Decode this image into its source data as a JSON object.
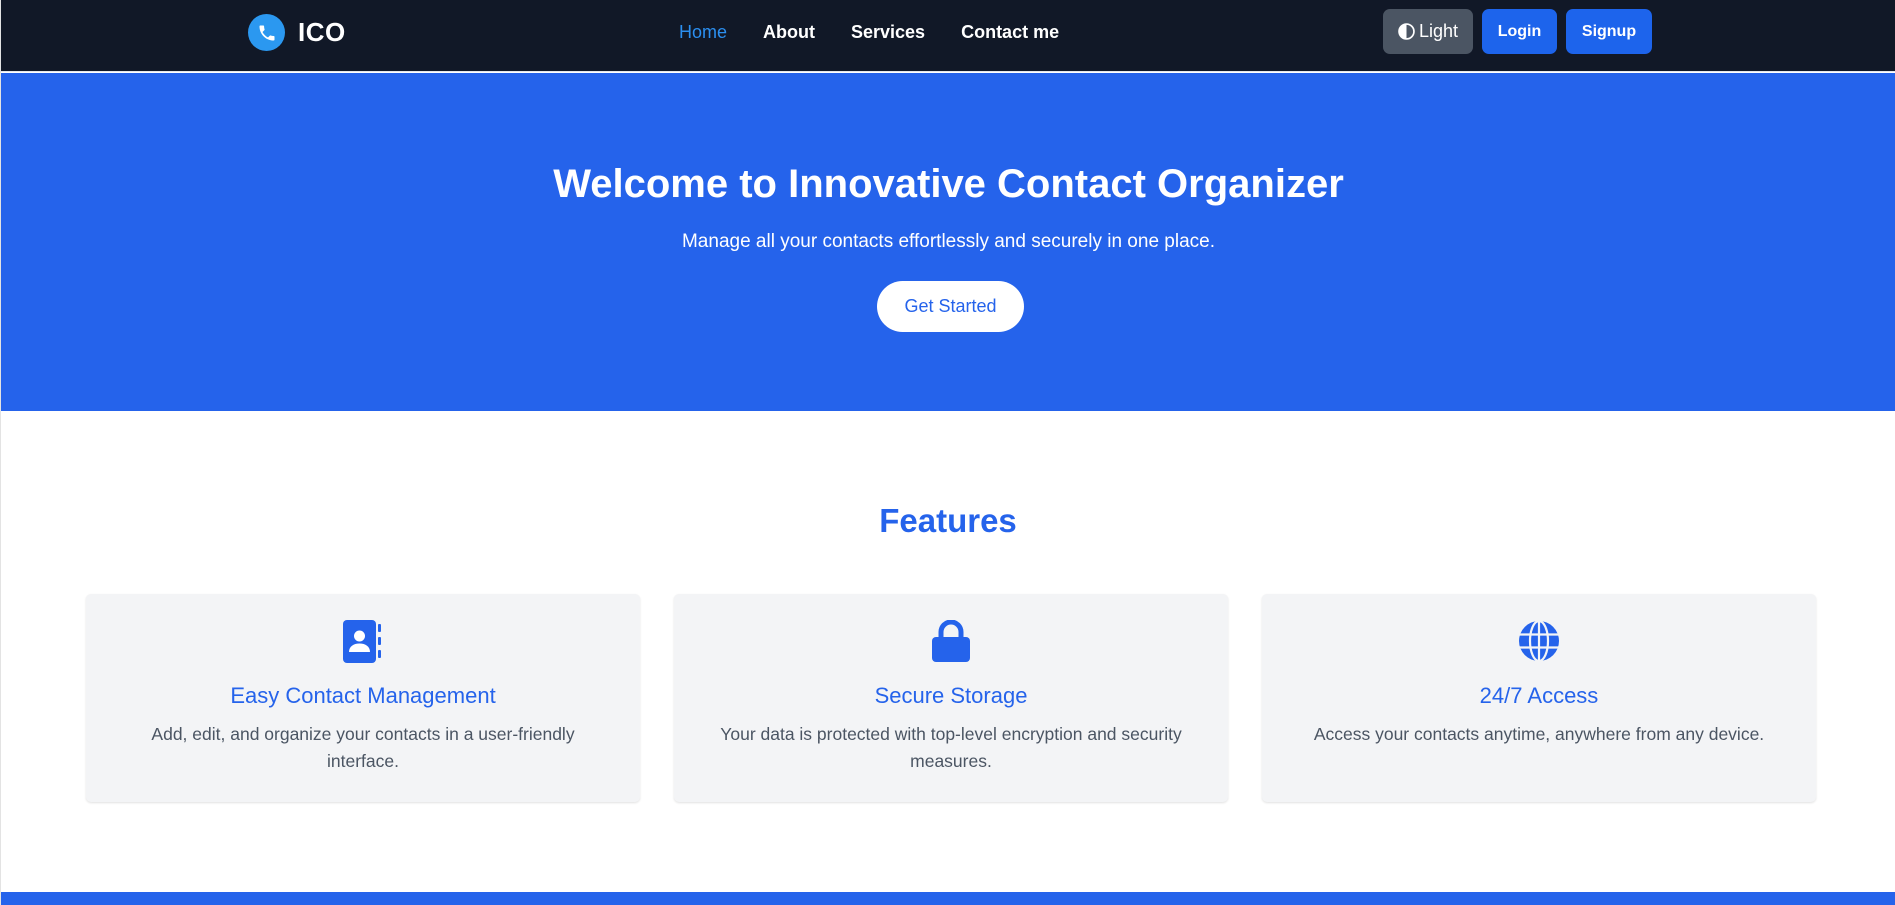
{
  "navbar": {
    "brand_icon": "phone-icon",
    "brand_text": "ICO",
    "links": [
      {
        "label": "Home",
        "active": true
      },
      {
        "label": "About",
        "active": false
      },
      {
        "label": "Services",
        "active": false
      },
      {
        "label": "Contact me",
        "active": false
      }
    ],
    "theme_toggle": {
      "icon": "half-circle-contrast-icon",
      "label": "Light"
    },
    "login_label": "Login",
    "signup_label": "Signup"
  },
  "hero": {
    "title": "Welcome to Innovative Contact Organizer",
    "subtitle": "Manage all your contacts effortlessly and securely in one place.",
    "cta_label": "Get Started"
  },
  "features": {
    "title": "Features",
    "cards": [
      {
        "icon": "address-book-icon",
        "title": "Easy Contact Management",
        "description": "Add, edit, and organize your contacts in a user-friendly interface."
      },
      {
        "icon": "lock-icon",
        "title": "Secure Storage",
        "description": "Your data is protected with top-level encryption and security measures."
      },
      {
        "icon": "globe-icon",
        "title": "24/7 Access",
        "description": "Access your contacts anytime, anywhere from any device."
      }
    ]
  },
  "colors": {
    "navbar_bg": "#111827",
    "primary": "#2563eb",
    "button_primary": "#1d64ec",
    "theme_button": "#4b5563",
    "active_link": "#2b8ff0",
    "card_bg": "#f3f4f6",
    "body_text": "#4b5563"
  }
}
